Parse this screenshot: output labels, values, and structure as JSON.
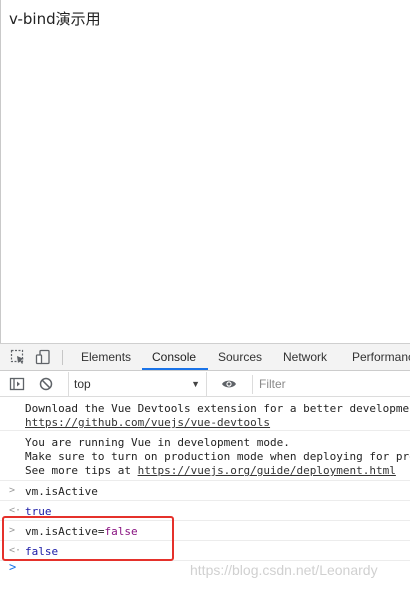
{
  "page": {
    "heading": "v-bind演示用"
  },
  "devtools": {
    "tabs": [
      {
        "label": "Elements"
      },
      {
        "label": "Console"
      },
      {
        "label": "Sources"
      },
      {
        "label": "Network"
      },
      {
        "label": "Performanc"
      }
    ],
    "active_tab": "Console",
    "toolbar": {
      "context": "top",
      "filter_placeholder": "Filter"
    },
    "icons": [
      "inspect-icon",
      "device-icon",
      "sidebar-icon",
      "clear-icon",
      "eye-icon"
    ]
  },
  "console": {
    "devtools_msg": {
      "line1": "Download the Vue Devtools extension for a better developmen",
      "line2": "https://github.com/vuejs/vue-devtools"
    },
    "dev_mode_msg": {
      "line1": "You are running Vue in development mode.",
      "line2": "Make sure to turn on production mode when deploying for pro",
      "line3_prefix": "See more tips at ",
      "line3_link": "https://vuejs.org/guide/deployment.html"
    },
    "entries": [
      {
        "input": "vm.isActive",
        "output": "true"
      },
      {
        "input_prefix": "vm.isActive=",
        "input_value": "false",
        "output": "false"
      }
    ]
  },
  "watermark": "https://blog.csdn.net/Leonardy",
  "colors": {
    "accent": "#1a73e8",
    "highlight": "#e5312b",
    "value": "#1a1aa6",
    "keyword": "#881280"
  }
}
